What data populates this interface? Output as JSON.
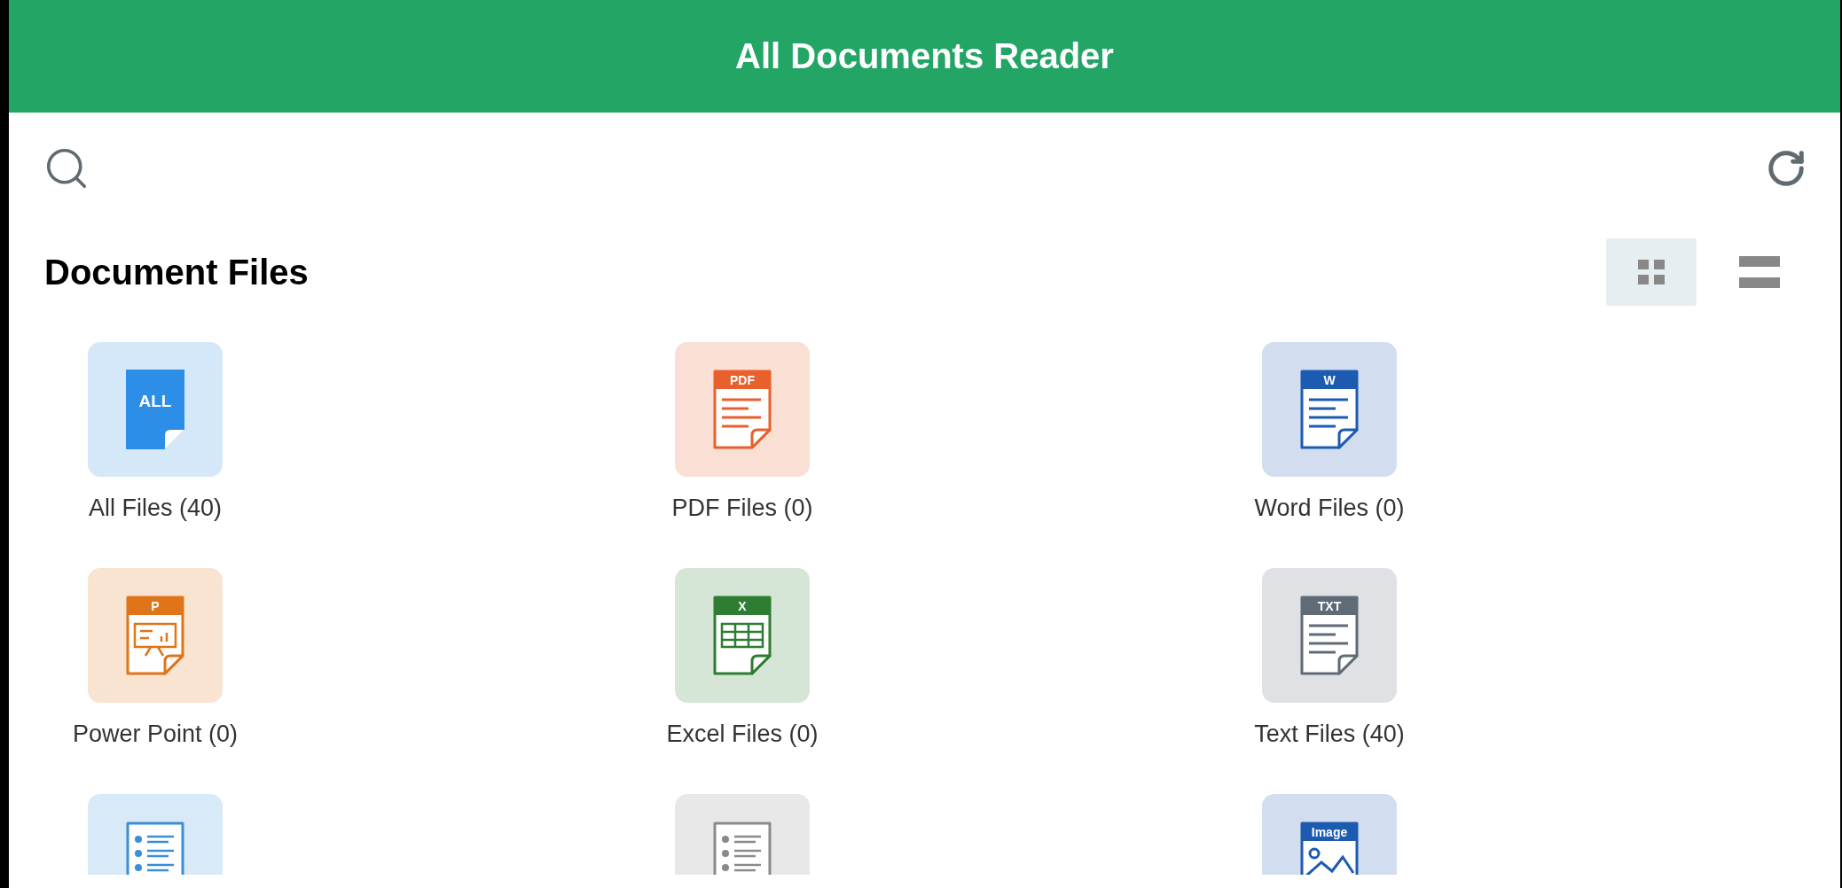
{
  "app_bar": {
    "title": "All Documents Reader"
  },
  "section": {
    "title": "Document Files"
  },
  "view_modes": [
    {
      "kind": "grid",
      "selected": true
    },
    {
      "kind": "list",
      "selected": false
    }
  ],
  "categories": [
    {
      "kind": "solid",
      "badge": "ALL",
      "color": "#2d8ee8",
      "label": "All Files (40)"
    },
    {
      "kind": "lines",
      "badge": "PDF",
      "color": "#e8602c",
      "label": "PDF Files (0)"
    },
    {
      "kind": "lines",
      "badge": "W",
      "color": "#1c5bb0",
      "label": "Word Files (0)"
    },
    {
      "kind": "slide",
      "badge": "P",
      "color": "#e07418",
      "label": "Power Point (0)"
    },
    {
      "kind": "table",
      "badge": "X",
      "color": "#2e7d32",
      "label": "Excel Files (0)"
    },
    {
      "kind": "lines",
      "badge": "TXT",
      "color": "#5f6b77",
      "label": "Text Files (40)"
    },
    {
      "kind": "list",
      "color": "#3a8fd6"
    },
    {
      "kind": "list",
      "color": "#8a8a8a"
    },
    {
      "kind": "image",
      "badge": "Image",
      "color": "#1c5bb0"
    }
  ]
}
